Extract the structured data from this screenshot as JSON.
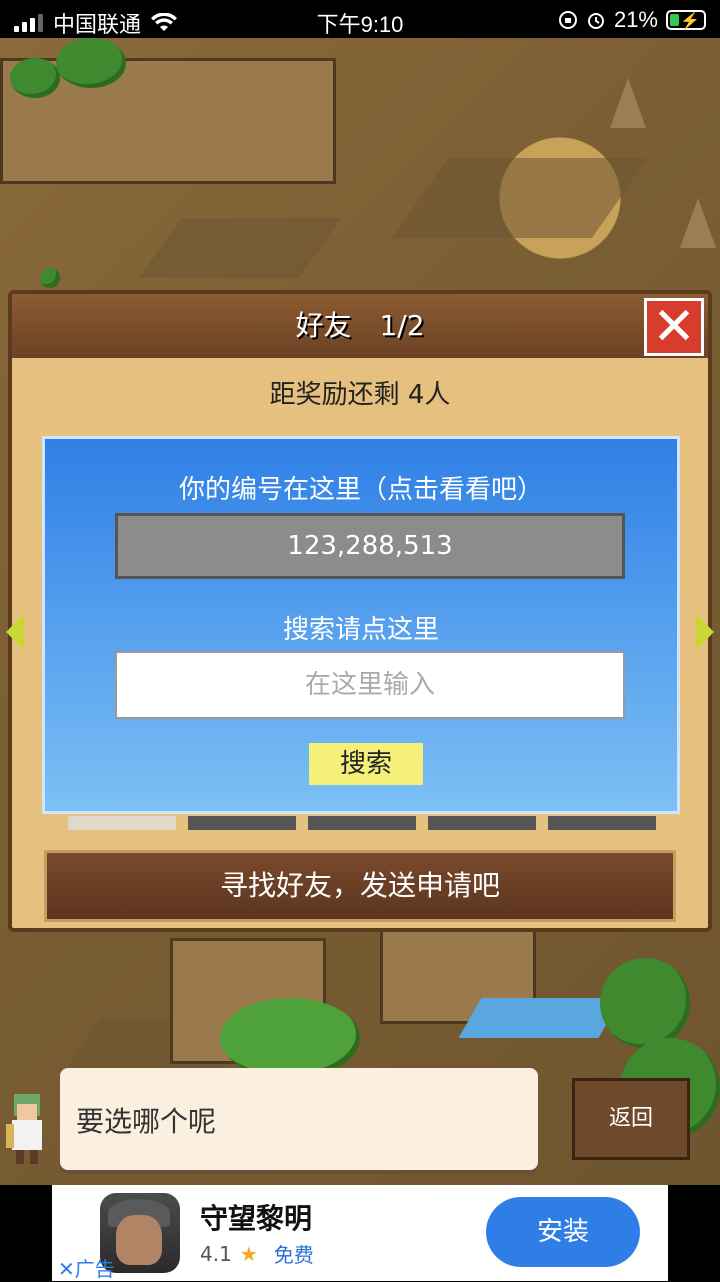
{
  "status_bar": {
    "carrier": "中国联通",
    "time": "下午9:10",
    "battery": "21%",
    "battery_level": 0.21
  },
  "dialog": {
    "title": "好友　1/2",
    "close_icon": "close-icon",
    "reward_text": "距奖励还剩 4人",
    "id_label": "你的编号在这里（点击看看吧）",
    "id_value": "123,288,513",
    "search_label": "搜索请点这里",
    "search_placeholder": "在这里输入",
    "search_button": "搜索",
    "find_button": "寻找好友，发送申请吧"
  },
  "bubble": {
    "text": "要选哪个呢"
  },
  "back_button": "返回",
  "ad": {
    "app_name": "守望黎明",
    "rating": "4.1",
    "price": "免费",
    "install": "安装",
    "label": "广告"
  },
  "colors": {
    "accent_blue": "#2f7ee6",
    "close_red": "#d73c2c",
    "dialog_bg": "#e6c07e"
  }
}
